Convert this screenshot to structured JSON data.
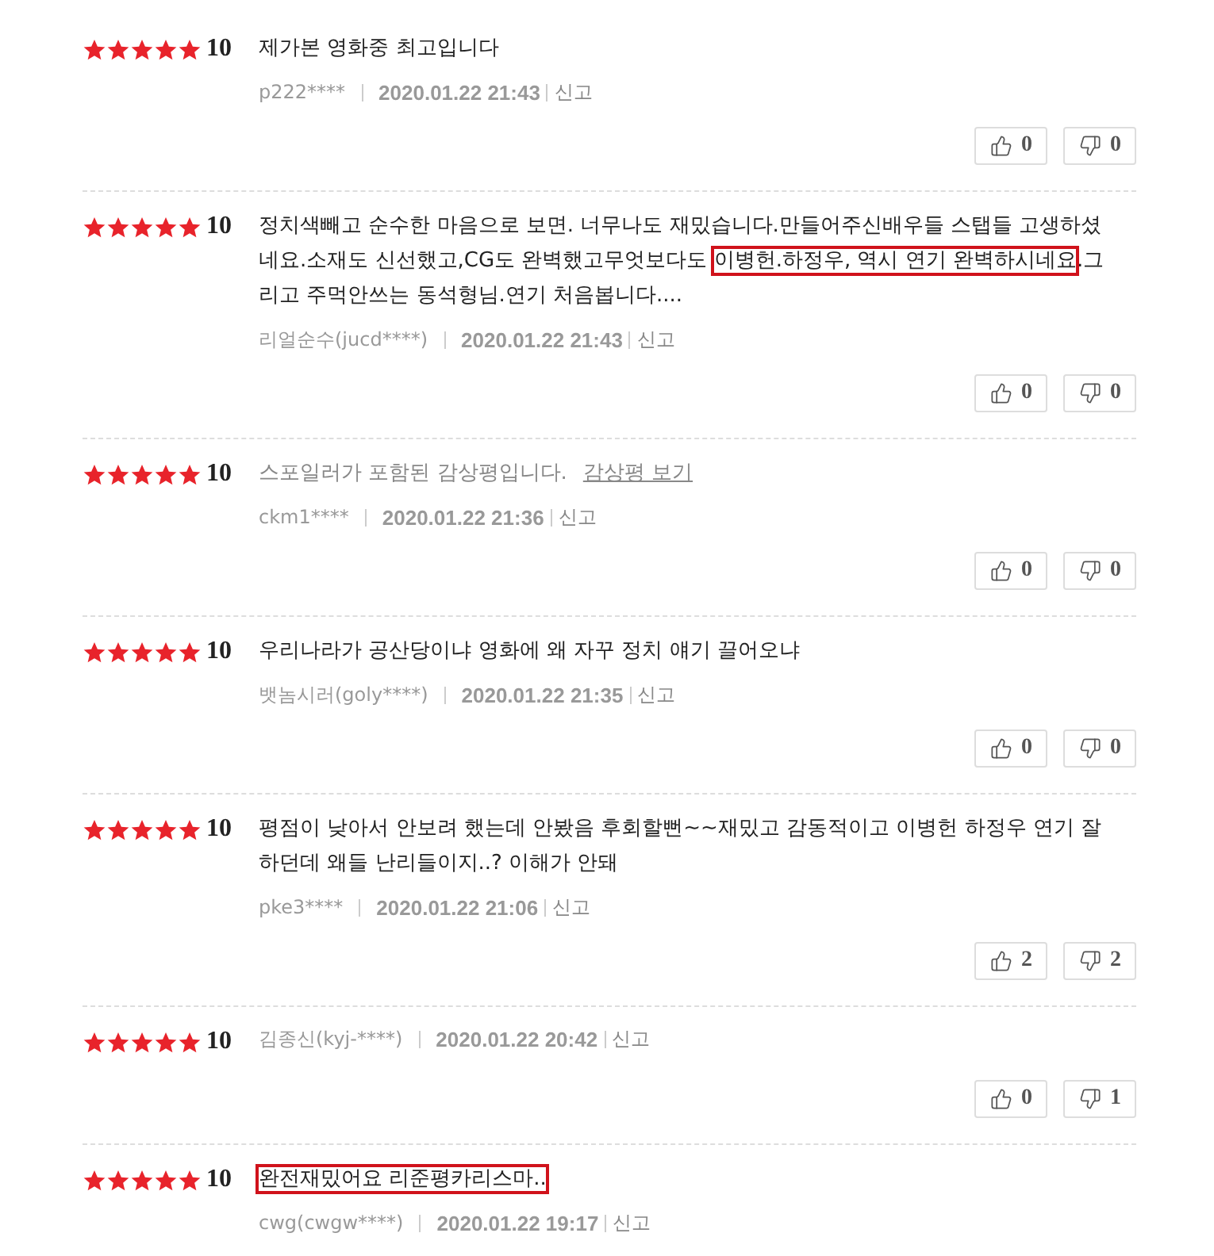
{
  "reviews": [
    {
      "kind": "text",
      "stars": 5,
      "score": "10",
      "segments": [
        {
          "text": "제가본 영화중 최고입니다",
          "highlighted": false
        }
      ],
      "author": "p222****",
      "date": "2020.01.22 21:43",
      "report": "신고",
      "likes": "0",
      "dislikes": "0"
    },
    {
      "kind": "text",
      "stars": 5,
      "score": "10",
      "segments": [
        {
          "text": "정치색빼고 순수한 마음으로 보면. 너무나도 재밌습니다.만들어주신배우들 스탭들 고생하셨네요.소재도 신선했고,CG도 완벽했고무엇보다도 ",
          "highlighted": false
        },
        {
          "text": "이병헌.하정우, 역시 연기 완벽하시네요",
          "highlighted": true
        },
        {
          "text": ".그리고 주먹안쓰는 동석형님.연기 처음봅니다....",
          "highlighted": false
        }
      ],
      "author": "리얼순수(jucd****)",
      "date": "2020.01.22 21:43",
      "report": "신고",
      "likes": "0",
      "dislikes": "0"
    },
    {
      "kind": "spoiler",
      "stars": 5,
      "score": "10",
      "notice": "스포일러가 포함된 감상평입니다.",
      "link": "감상평 보기",
      "author": "ckm1****",
      "date": "2020.01.22 21:36",
      "report": "신고",
      "likes": "0",
      "dislikes": "0"
    },
    {
      "kind": "text",
      "stars": 5,
      "score": "10",
      "segments": [
        {
          "text": "우리나라가 공산당이냐 영화에 왜 자꾸 정치 얘기 끌어오냐",
          "highlighted": false
        }
      ],
      "author": "뱃놈시러(goly****)",
      "date": "2020.01.22 21:35",
      "report": "신고",
      "likes": "0",
      "dislikes": "0"
    },
    {
      "kind": "text",
      "stars": 5,
      "score": "10",
      "segments": [
        {
          "text": "평점이 낮아서 안보려 했는데 안봤음 후회할뻔~~재밌고 감동적이고 이병헌 하정우 연기 잘하던데 왜들 난리들이지..? 이해가 안돼",
          "highlighted": false
        }
      ],
      "author": "pke3****",
      "date": "2020.01.22 21:06",
      "report": "신고",
      "likes": "2",
      "dislikes": "2"
    },
    {
      "kind": "empty",
      "stars": 5,
      "score": "10",
      "author": "김종신(kyj-****)",
      "date": "2020.01.22 20:42",
      "report": "신고",
      "likes": "0",
      "dislikes": "1"
    },
    {
      "kind": "text",
      "stars": 5,
      "score": "10",
      "segments": [
        {
          "text": "완전재밌어요 리준평카리스마..",
          "highlighted": true
        }
      ],
      "author": "cwg(cwgw****)",
      "date": "2020.01.22 19:17",
      "report": "신고"
    }
  ]
}
